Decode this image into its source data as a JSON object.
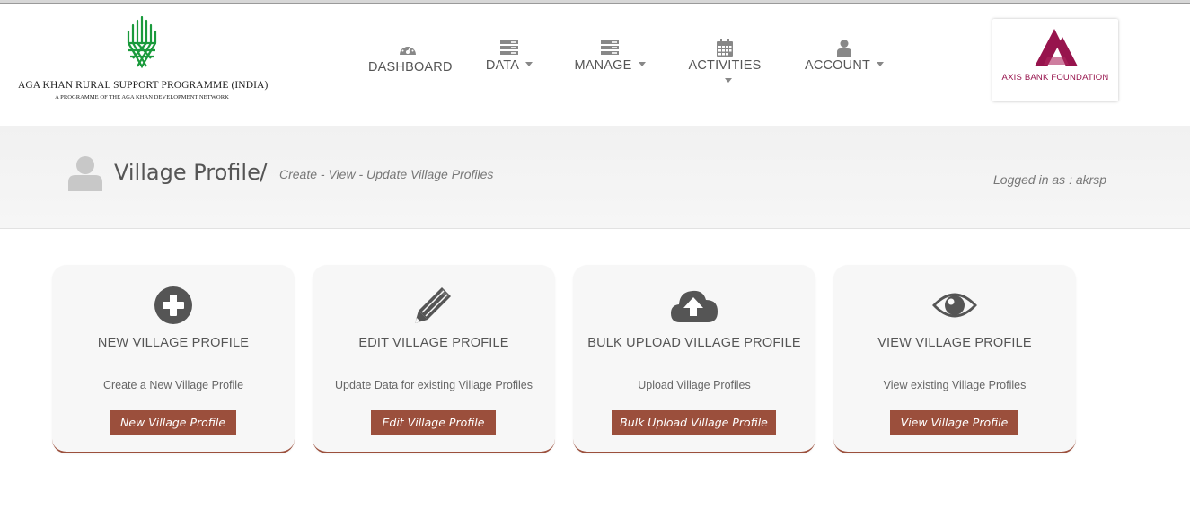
{
  "header": {
    "org_title": "AGA KHAN RURAL SUPPORT PROGRAMME (INDIA)",
    "org_subtitle": "A PROGRAMME OF THE AGA KHAN DEVELOPMENT NETWORK",
    "partner_name": "AXIS BANK FOUNDATION"
  },
  "nav": {
    "items": [
      {
        "label": "DASHBOARD",
        "icon": "dashboard-icon"
      },
      {
        "label": "DATA",
        "icon": "server-icon"
      },
      {
        "label": "MANAGE",
        "icon": "server-icon"
      },
      {
        "label": "ACTIVITIES",
        "icon": "calendar-icon"
      },
      {
        "label": "ACCOUNT",
        "icon": "user-icon"
      }
    ]
  },
  "banner": {
    "title": "Village Profile",
    "separator": "/",
    "subtitle": "Create - View - Update Village Profiles",
    "logged_in": "Logged in as : akrsp"
  },
  "cards": [
    {
      "title": "NEW VILLAGE PROFILE",
      "description": "Create a New Village Profile",
      "button": "New Village Profile",
      "icon": "plus-circle-icon"
    },
    {
      "title": "EDIT VILLAGE PROFILE",
      "description": "Update Data for existing Village Profiles",
      "button": "Edit Village Profile",
      "icon": "pencil-icon"
    },
    {
      "title": "BULK UPLOAD VILLAGE PROFILE",
      "description": "Upload Village Profiles",
      "button": "Bulk Upload Village Profile",
      "icon": "cloud-upload-icon"
    },
    {
      "title": "VIEW VILLAGE PROFILE",
      "description": "View existing Village Profiles",
      "button": "View Village Profile",
      "icon": "eye-icon"
    }
  ],
  "colors": {
    "accent": "#9b4f3c",
    "akrsp_green": "#1a9a3c",
    "axis_maroon": "#97144d",
    "icon_gray": "#555555"
  }
}
